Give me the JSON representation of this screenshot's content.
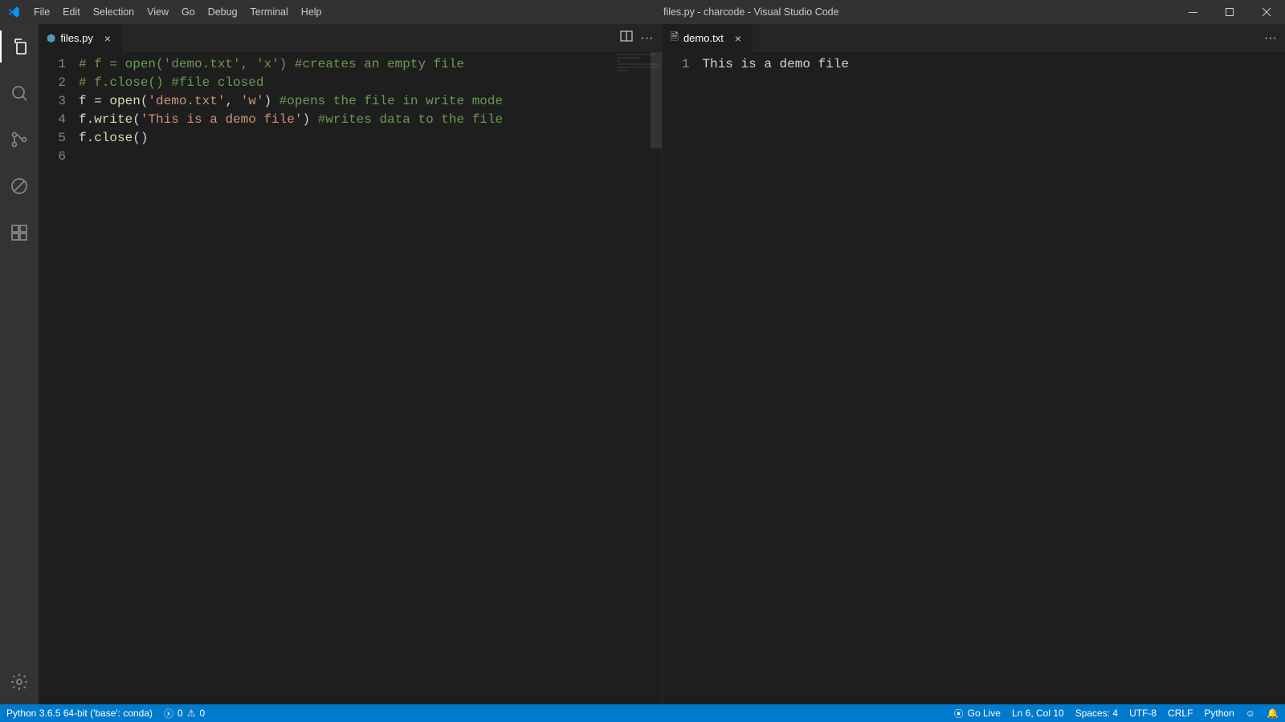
{
  "window": {
    "title": "files.py - charcode - Visual Studio Code"
  },
  "menu": [
    "File",
    "Edit",
    "Selection",
    "View",
    "Go",
    "Debug",
    "Terminal",
    "Help"
  ],
  "activity": {
    "items": [
      {
        "name": "explorer",
        "active": true
      },
      {
        "name": "search",
        "active": false
      },
      {
        "name": "scm",
        "active": false
      },
      {
        "name": "debug-disabled",
        "active": false
      },
      {
        "name": "extensions",
        "active": false
      }
    ],
    "bottom": {
      "name": "settings"
    }
  },
  "editors": {
    "left": {
      "tab": {
        "filename": "files.py",
        "close": "×",
        "modified": false,
        "lang": "python"
      },
      "lines": [
        {
          "n": 1,
          "segments": [
            {
              "cls": "tok-comment",
              "t": "# f = open('demo.txt', 'x') #creates an empty file"
            }
          ]
        },
        {
          "n": 2,
          "segments": [
            {
              "cls": "tok-comment",
              "t": "# f.close() #file closed"
            }
          ]
        },
        {
          "n": 3,
          "segments": [
            {
              "cls": "",
              "t": ""
            }
          ]
        },
        {
          "n": 4,
          "segments": [
            {
              "cls": "tok-var",
              "t": "f = "
            },
            {
              "cls": "tok-builtin",
              "t": "open"
            },
            {
              "cls": "tok-var",
              "t": "("
            },
            {
              "cls": "tok-str",
              "t": "'demo.txt'"
            },
            {
              "cls": "tok-var",
              "t": ", "
            },
            {
              "cls": "tok-str",
              "t": "'w'"
            },
            {
              "cls": "tok-var",
              "t": ") "
            },
            {
              "cls": "tok-comment",
              "t": "#opens the file in write mode"
            }
          ]
        },
        {
          "n": 5,
          "segments": [
            {
              "cls": "tok-var",
              "t": "f."
            },
            {
              "cls": "tok-func",
              "t": "write"
            },
            {
              "cls": "tok-var",
              "t": "("
            },
            {
              "cls": "tok-str",
              "t": "'This is a demo file'"
            },
            {
              "cls": "tok-var",
              "t": ") "
            },
            {
              "cls": "tok-comment",
              "t": "#writes data to the file"
            }
          ]
        },
        {
          "n": 6,
          "segments": [
            {
              "cls": "tok-var",
              "t": "f."
            },
            {
              "cls": "tok-func",
              "t": "close"
            },
            {
              "cls": "tok-var",
              "t": "()"
            }
          ]
        }
      ]
    },
    "right": {
      "tab": {
        "filename": "demo.txt",
        "close": "×",
        "lang": "text"
      },
      "lines": [
        {
          "n": 1,
          "segments": [
            {
              "cls": "",
              "t": "This is a demo file"
            }
          ]
        }
      ]
    }
  },
  "status": {
    "python": "Python 3.6.5 64-bit ('base': conda)",
    "errors": "0",
    "warnings": "0",
    "golive": "Go Live",
    "cursor": "Ln 6, Col 10",
    "spaces": "Spaces: 4",
    "encoding": "UTF-8",
    "eol": "CRLF",
    "language": "Python"
  },
  "icons": {
    "splitHoriz": "▯▯",
    "more": "···"
  }
}
